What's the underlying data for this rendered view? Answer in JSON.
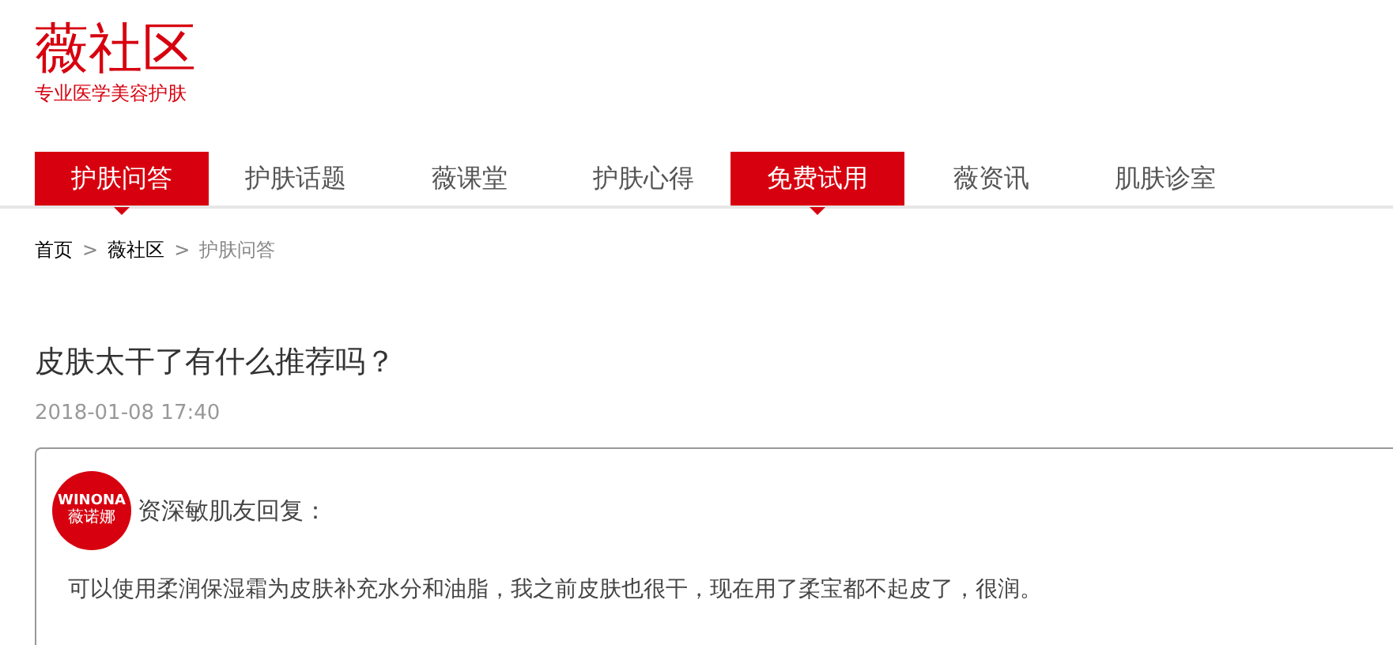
{
  "header": {
    "logo": "薇社区",
    "tagline": "专业医学美容护肤"
  },
  "nav": [
    {
      "label": "护肤问答",
      "selected": true
    },
    {
      "label": "护肤话题",
      "selected": false
    },
    {
      "label": "薇课堂",
      "selected": false
    },
    {
      "label": "护肤心得",
      "selected": false
    },
    {
      "label": "免费试用",
      "selected": true
    },
    {
      "label": "薇资讯",
      "selected": false
    },
    {
      "label": "肌肤诊室",
      "selected": false
    }
  ],
  "breadcrumb": [
    {
      "label": "首页",
      "current": false
    },
    {
      "label": "薇社区",
      "current": false
    },
    {
      "label": "护肤问答",
      "current": true
    }
  ],
  "breadcrumb_separator": ">",
  "question": {
    "title": "皮肤太干了有什么推荐吗？",
    "date": "2018-01-08 17:40"
  },
  "reply": {
    "avatar": {
      "brand": "WINONA",
      "brand_cn": "薇诺娜"
    },
    "author": "资深敏肌友回复：",
    "text": "可以使用柔润保湿霜为皮肤补充水分和油脂，我之前皮肤也很干，现在用了柔宝都不起皮了，很润。"
  }
}
